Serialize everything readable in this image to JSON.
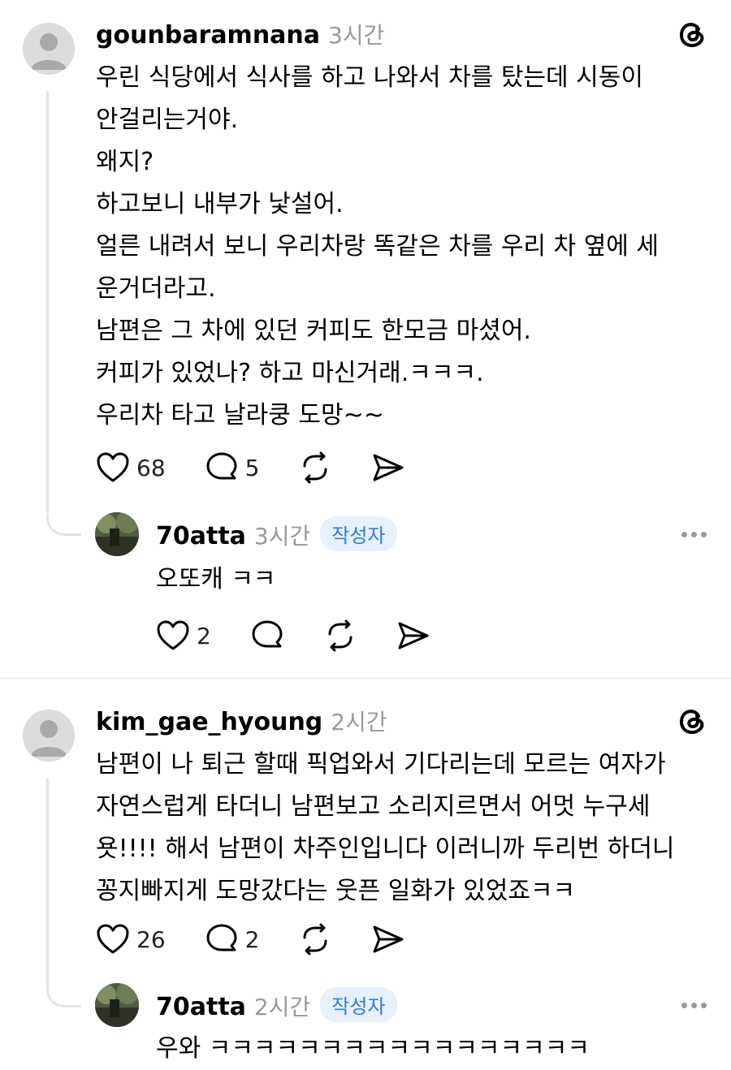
{
  "comments": [
    {
      "username": "gounbaramnana",
      "time": "3시간",
      "lines": [
        "우린 식당에서 식사를 하고 나와서 차를 탔는데 시동이",
        "안걸리는거야.",
        "왜지?",
        "하고보니 내부가 낯설어.",
        "얼른 내려서 보니 우리차랑 똑같은 차를 우리 차 옆에 세",
        "운거더라고.",
        "남편은 그 차에 있던 커피도 한모금 마셨어.",
        "커피가 있었나? 하고 마신거래.ㅋㅋㅋ.",
        "우리차 타고 날라쿵 도망~~"
      ],
      "likes": "68",
      "replies": "5",
      "reply": {
        "username": "70atta",
        "time": "3시간",
        "badge": "작성자",
        "text": "오또캐 ㅋㅋ",
        "likes": "2"
      }
    },
    {
      "username": "kim_gae_hyoung",
      "time": "2시간",
      "lines": [
        "남편이 나 퇴근 할때 픽업와서 기다리는데 모르는 여자가",
        "자연스럽게 타더니 남편보고 소리지르면서 어멋 누구세",
        "욧!!!! 해서 남편이 차주인입니다 이러니까 두리번 하더니",
        "꽁지빠지게 도망갔다는 웃픈 일화가 있었죠ㅋㅋ"
      ],
      "likes": "26",
      "replies": "2",
      "reply": {
        "username": "70atta",
        "time": "2시간",
        "badge": "작성자",
        "text": "우와 ㅋㅋㅋㅋㅋㅋㅋㅋㅋㅋㅋㅋㅋㅋㅋㅋㅋ"
      }
    }
  ]
}
